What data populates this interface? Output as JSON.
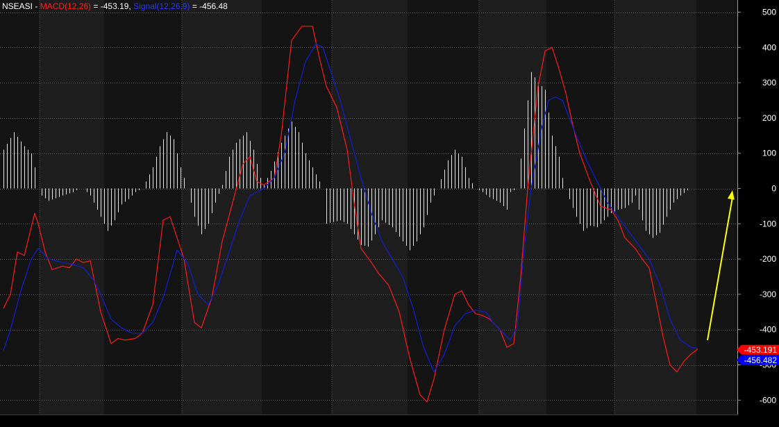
{
  "chart_data": {
    "type": "line",
    "header": {
      "symbol": "NSEASI",
      "sep": " - ",
      "macd_label": "MACD(12,26)",
      "macd_value": " = -453.19, ",
      "signal_label": "Signal(12,26,9)",
      "signal_value": " = -456.48"
    },
    "ylim": [
      -650,
      530
    ],
    "y_ticks": [
      500,
      400,
      300,
      200,
      100,
      0,
      -100,
      -200,
      -300,
      -400,
      -500,
      -600
    ],
    "y_tick_labels": [
      "500",
      "400",
      "300",
      "200",
      "100",
      "0",
      "-100",
      "-200",
      "-300",
      "-400",
      "-500",
      "-600"
    ],
    "grid": true,
    "colors": {
      "background": "#000000",
      "band_dark": "#141414",
      "band_light": "#1e1e1e",
      "grid": "#5a5a5a",
      "macd": "#ff1a1a",
      "signal": "#1020d8",
      "histogram": "#e6e6e6",
      "arrow": "#ffff00",
      "macd_badge": "#ff0000",
      "signal_badge": "#0000ff"
    },
    "x_count": 200,
    "series": [
      {
        "name": "MACD(12,26)",
        "points": [
          [
            0,
            -340
          ],
          [
            2,
            -300
          ],
          [
            4,
            -180
          ],
          [
            6,
            -190
          ],
          [
            8,
            -110
          ],
          [
            9,
            -70
          ],
          [
            10,
            -100
          ],
          [
            12,
            -180
          ],
          [
            14,
            -230
          ],
          [
            17,
            -220
          ],
          [
            19,
            -225
          ],
          [
            21,
            -200
          ],
          [
            23,
            -210
          ],
          [
            25,
            -205
          ],
          [
            28,
            -350
          ],
          [
            31,
            -440
          ],
          [
            33,
            -425
          ],
          [
            35,
            -430
          ],
          [
            38,
            -425
          ],
          [
            40,
            -410
          ],
          [
            43,
            -330
          ],
          [
            46,
            -90
          ],
          [
            48,
            -80
          ],
          [
            52,
            -200
          ],
          [
            55,
            -380
          ],
          [
            57,
            -395
          ],
          [
            60,
            -310
          ],
          [
            63,
            -150
          ],
          [
            66,
            -40
          ],
          [
            69,
            70
          ],
          [
            71,
            90
          ],
          [
            73,
            20
          ],
          [
            75,
            10
          ],
          [
            78,
            30
          ],
          [
            80,
            150
          ],
          [
            83,
            420
          ],
          [
            86,
            460
          ],
          [
            89,
            460
          ],
          [
            91,
            370
          ],
          [
            93,
            290
          ],
          [
            96,
            230
          ],
          [
            99,
            110
          ],
          [
            101,
            -40
          ],
          [
            103,
            -170
          ],
          [
            106,
            -210
          ],
          [
            108,
            -240
          ],
          [
            111,
            -275
          ],
          [
            114,
            -350
          ],
          [
            117,
            -480
          ],
          [
            120,
            -585
          ],
          [
            122,
            -605
          ],
          [
            124,
            -540
          ],
          [
            127,
            -400
          ],
          [
            130,
            -300
          ],
          [
            132,
            -290
          ],
          [
            134,
            -330
          ],
          [
            136,
            -355
          ],
          [
            138,
            -360
          ],
          [
            140,
            -370
          ],
          [
            143,
            -400
          ],
          [
            145,
            -450
          ],
          [
            147,
            -440
          ],
          [
            149,
            -250
          ],
          [
            151,
            0
          ],
          [
            154,
            290
          ],
          [
            156,
            390
          ],
          [
            158,
            400
          ],
          [
            160,
            340
          ],
          [
            162,
            270
          ],
          [
            164,
            180
          ],
          [
            166,
            100
          ],
          [
            169,
            20
          ],
          [
            172,
            -50
          ],
          [
            175,
            -60
          ],
          [
            177,
            -90
          ],
          [
            179,
            -140
          ],
          [
            182,
            -170
          ],
          [
            184,
            -200
          ],
          [
            186,
            -225
          ],
          [
            188,
            -320
          ],
          [
            190,
            -420
          ],
          [
            192,
            -500
          ],
          [
            194,
            -520
          ],
          [
            196,
            -490
          ],
          [
            198,
            -470
          ],
          [
            200,
            -455
          ]
        ]
      },
      {
        "name": "Signal(12,26,9)",
        "points": [
          [
            0,
            -460
          ],
          [
            2,
            -400
          ],
          [
            5,
            -290
          ],
          [
            8,
            -200
          ],
          [
            10,
            -170
          ],
          [
            13,
            -200
          ],
          [
            17,
            -210
          ],
          [
            20,
            -215
          ],
          [
            23,
            -225
          ],
          [
            26,
            -260
          ],
          [
            28,
            -300
          ],
          [
            31,
            -370
          ],
          [
            34,
            -395
          ],
          [
            37,
            -410
          ],
          [
            40,
            -410
          ],
          [
            43,
            -380
          ],
          [
            46,
            -310
          ],
          [
            50,
            -175
          ],
          [
            53,
            -210
          ],
          [
            56,
            -300
          ],
          [
            59,
            -330
          ],
          [
            62,
            -270
          ],
          [
            65,
            -180
          ],
          [
            68,
            -90
          ],
          [
            71,
            -20
          ],
          [
            75,
            0
          ],
          [
            78,
            30
          ],
          [
            81,
            100
          ],
          [
            84,
            250
          ],
          [
            87,
            360
          ],
          [
            90,
            410
          ],
          [
            92,
            400
          ],
          [
            94,
            340
          ],
          [
            97,
            250
          ],
          [
            100,
            140
          ],
          [
            103,
            30
          ],
          [
            106,
            -70
          ],
          [
            109,
            -150
          ],
          [
            112,
            -200
          ],
          [
            115,
            -250
          ],
          [
            118,
            -340
          ],
          [
            121,
            -450
          ],
          [
            124,
            -520
          ],
          [
            127,
            -470
          ],
          [
            130,
            -390
          ],
          [
            133,
            -355
          ],
          [
            136,
            -345
          ],
          [
            139,
            -350
          ],
          [
            141,
            -380
          ],
          [
            144,
            -410
          ],
          [
            146,
            -430
          ],
          [
            148,
            -390
          ],
          [
            150,
            -170
          ],
          [
            152,
            0
          ],
          [
            155,
            170
          ],
          [
            157,
            250
          ],
          [
            159,
            260
          ],
          [
            161,
            250
          ],
          [
            163,
            200
          ],
          [
            165,
            150
          ],
          [
            168,
            80
          ],
          [
            171,
            20
          ],
          [
            174,
            -40
          ],
          [
            177,
            -80
          ],
          [
            180,
            -120
          ],
          [
            183,
            -160
          ],
          [
            186,
            -200
          ],
          [
            189,
            -270
          ],
          [
            192,
            -370
          ],
          [
            195,
            -430
          ],
          [
            198,
            -450
          ],
          [
            200,
            -453
          ]
        ]
      }
    ],
    "histogram": {
      "name": "MACD - Signal",
      "points": [
        [
          0,
          110
        ],
        [
          3,
          160
        ],
        [
          6,
          120
        ],
        [
          8,
          100
        ],
        [
          9,
          60
        ],
        [
          10,
          0
        ],
        [
          11,
          -20
        ],
        [
          13,
          -35
        ],
        [
          17,
          -20
        ],
        [
          20,
          -10
        ],
        [
          22,
          0
        ],
        [
          23,
          0
        ],
        [
          25,
          -20
        ],
        [
          28,
          -80
        ],
        [
          30,
          -120
        ],
        [
          32,
          -90
        ],
        [
          34,
          -45
        ],
        [
          36,
          -30
        ],
        [
          38,
          -10
        ],
        [
          40,
          0
        ],
        [
          43,
          60
        ],
        [
          45,
          120
        ],
        [
          47,
          160
        ],
        [
          49,
          140
        ],
        [
          51,
          60
        ],
        [
          53,
          0
        ],
        [
          55,
          -80
        ],
        [
          57,
          -130
        ],
        [
          59,
          -100
        ],
        [
          61,
          -40
        ],
        [
          63,
          10
        ],
        [
          65,
          90
        ],
        [
          67,
          130
        ],
        [
          70,
          160
        ],
        [
          72,
          110
        ],
        [
          74,
          30
        ],
        [
          75,
          10
        ],
        [
          77,
          50
        ],
        [
          80,
          130
        ],
        [
          83,
          190
        ],
        [
          85,
          160
        ],
        [
          87,
          100
        ],
        [
          90,
          40
        ],
        [
          92,
          0
        ],
        [
          93,
          -100
        ],
        [
          97,
          -90
        ],
        [
          99,
          -100
        ],
        [
          101,
          -130
        ],
        [
          103,
          -160
        ],
        [
          105,
          -165
        ],
        [
          107,
          -130
        ],
        [
          109,
          -90
        ],
        [
          112,
          -110
        ],
        [
          115,
          -150
        ],
        [
          117,
          -175
        ],
        [
          119,
          -150
        ],
        [
          121,
          -110
        ],
        [
          123,
          -40
        ],
        [
          125,
          0
        ],
        [
          128,
          80
        ],
        [
          130,
          110
        ],
        [
          132,
          90
        ],
        [
          134,
          30
        ],
        [
          136,
          0
        ],
        [
          138,
          -10
        ],
        [
          140,
          -25
        ],
        [
          143,
          -40
        ],
        [
          145,
          -60
        ],
        [
          146,
          -10
        ],
        [
          148,
          0
        ],
        [
          150,
          170
        ],
        [
          152,
          330
        ],
        [
          154,
          300
        ],
        [
          156,
          280
        ],
        [
          158,
          150
        ],
        [
          160,
          90
        ],
        [
          161,
          30
        ],
        [
          162,
          0
        ],
        [
          163,
          -30
        ],
        [
          165,
          -80
        ],
        [
          167,
          -120
        ],
        [
          169,
          -105
        ],
        [
          171,
          -110
        ],
        [
          173,
          -90
        ],
        [
          175,
          -70
        ],
        [
          177,
          -60
        ],
        [
          179,
          -55
        ],
        [
          181,
          -40
        ],
        [
          182,
          -20
        ],
        [
          183,
          -60
        ],
        [
          185,
          -120
        ],
        [
          187,
          -140
        ],
        [
          189,
          -125
        ],
        [
          191,
          -80
        ],
        [
          193,
          -40
        ],
        [
          195,
          -20
        ],
        [
          197,
          -5
        ],
        [
          198,
          0
        ]
      ]
    },
    "badges": [
      {
        "label": "-453.191",
        "value": -453.19
      },
      {
        "label": "-456.482",
        "value": -456.48
      }
    ],
    "arrow": {
      "from": [
        200,
        -430
      ],
      "to": [
        206,
        -5
      ]
    }
  }
}
